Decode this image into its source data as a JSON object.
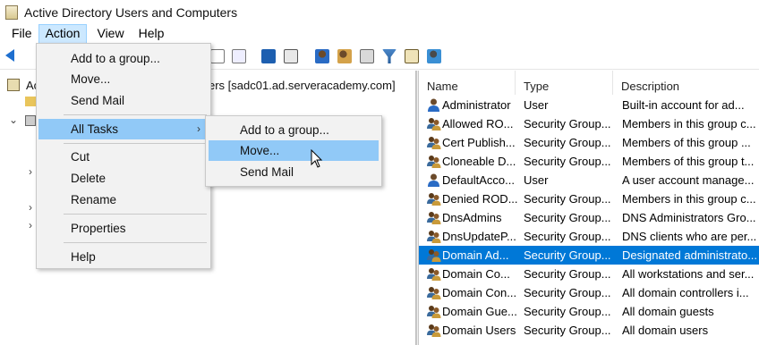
{
  "window": {
    "title": "Active Directory Users and Computers"
  },
  "menubar": {
    "items": [
      "File",
      "Action",
      "View",
      "Help"
    ]
  },
  "tree": {
    "root_label_fragment": "Ac",
    "root_label_suffix": "ers [sadc01.ad.serveracademy.com]"
  },
  "action_menu": {
    "items": [
      "Add to a group...",
      "Move...",
      "Send Mail",
      "All Tasks",
      "Cut",
      "Delete",
      "Rename",
      "Properties",
      "Help"
    ]
  },
  "all_tasks_submenu": {
    "items": [
      "Add to a group...",
      "Move...",
      "Send Mail"
    ]
  },
  "list": {
    "columns": [
      "Name",
      "Type",
      "Description"
    ],
    "rows": [
      {
        "name": "Administrator",
        "type": "User",
        "description": "Built-in account for ad..."
      },
      {
        "name": "Allowed RO...",
        "type": "Security Group...",
        "description": "Members in this group c..."
      },
      {
        "name": "Cert Publish...",
        "type": "Security Group...",
        "description": "Members of this group ..."
      },
      {
        "name": "Cloneable D...",
        "type": "Security Group...",
        "description": "Members of this group t..."
      },
      {
        "name": "DefaultAcco...",
        "type": "User",
        "description": "A user account manage..."
      },
      {
        "name": "Denied ROD...",
        "type": "Security Group...",
        "description": "Members in this group c..."
      },
      {
        "name": "DnsAdmins",
        "type": "Security Group...",
        "description": "DNS Administrators Gro..."
      },
      {
        "name": "DnsUpdateP...",
        "type": "Security Group...",
        "description": "DNS clients who are per..."
      },
      {
        "name": "Domain Ad...",
        "type": "Security Group...",
        "description": "Designated administrato..."
      },
      {
        "name": "Domain Co...",
        "type": "Security Group...",
        "description": "All workstations and ser..."
      },
      {
        "name": "Domain Con...",
        "type": "Security Group...",
        "description": "All domain controllers i..."
      },
      {
        "name": "Domain Gue...",
        "type": "Security Group...",
        "description": "All domain guests"
      },
      {
        "name": "Domain Users",
        "type": "Security Group...",
        "description": "All domain users"
      }
    ]
  },
  "colors": {
    "selection": "#0078d7",
    "menu_highlight": "#91c9f7",
    "accent": "#1e6fcf"
  }
}
